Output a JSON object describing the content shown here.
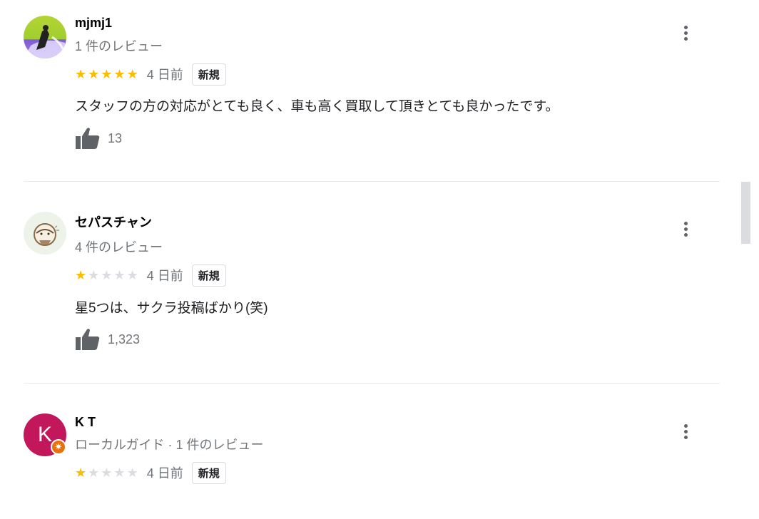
{
  "reviews": [
    {
      "name": "mjmj1",
      "meta": "1 件のレビュー",
      "stars": 5,
      "date": "4 日前",
      "badge": "新規",
      "text": "スタッフの方の対応がとても良く、車も高く買取して頂きとても良かったです。",
      "likes": "13"
    },
    {
      "name": "セパスチャン",
      "meta": "4 件のレビュー",
      "stars": 1,
      "date": "4 日前",
      "badge": "新規",
      "text": "星5つは、サクラ投稿ばかり(笑)",
      "likes": "1,323"
    },
    {
      "name": "K T",
      "avatar_letter": "K",
      "meta": "ローカルガイド · 1 件のレビュー",
      "stars": 1,
      "date": "4 日前",
      "badge": "新規"
    }
  ],
  "colors": {
    "star_on": "#fbbc04",
    "star_off": "#dadce0",
    "avatar_kt": "#c2185b",
    "local_guide_badge": "#e8710a"
  },
  "icons": [
    "thumb-up-icon",
    "more-vert-icon",
    "star-icon",
    "local-guide-icon"
  ]
}
